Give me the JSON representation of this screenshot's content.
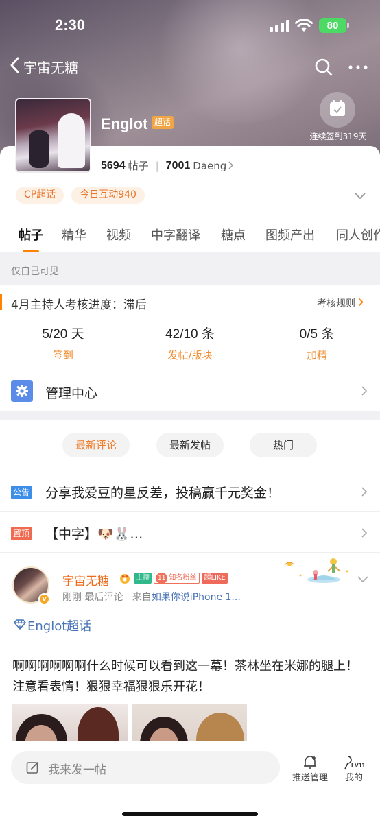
{
  "status_bar": {
    "time": "2:30",
    "battery": "80"
  },
  "nav": {
    "back_title": "宇宙无糖"
  },
  "topic": {
    "name": "Englot",
    "badge": "超话",
    "checkin_text": "连续签到319天",
    "posts_count": "5694",
    "posts_label": "帖子",
    "members_count": "7001",
    "members_label": "Daeng",
    "tags": [
      "CP超话",
      "今日互动940"
    ]
  },
  "tabs": [
    "帖子",
    "精华",
    "视频",
    "中字翻译",
    "糖点",
    "图频产出",
    "同人创作"
  ],
  "only_visible": "仅自己可见",
  "host_review": {
    "title": "4月主持人考核进度：滞后",
    "rule_link": "考核规则",
    "metrics": [
      {
        "value": "5/20 天",
        "label": "签到"
      },
      {
        "value": "42/10 条",
        "label": "发帖/版块"
      },
      {
        "value": "0/5 条",
        "label": "加精"
      }
    ],
    "management": "管理中心"
  },
  "sort_options": [
    "最新评论",
    "最新发帖",
    "热门"
  ],
  "notices": [
    {
      "badge": "公告",
      "text": "分享我爱豆的星反差，投稿赢千元奖金！",
      "color": "#3d8ee8"
    },
    {
      "badge": "置顶",
      "text": "【中字】🐶🐰…",
      "color": "#f06a52"
    }
  ],
  "post": {
    "user": "宇宙无糖",
    "badges": {
      "host": "主持",
      "fan": "知名粉丝",
      "fan_level": "11",
      "like": "超LIKE"
    },
    "time": "刚刚",
    "action": "最后评论",
    "source_prefix": "来自",
    "source": "如果你说iPhone 1...",
    "topic": "Englot超话",
    "text": "啊啊啊啊啊啊什么时候可以看到这一幕！茶林坐在米娜的腿上！注意看表情！狠狠幸福狠狠乐开花！"
  },
  "bottom_bar": {
    "compose_placeholder": "我来发一帖",
    "push_label": "推送管理",
    "mine_label": "我的",
    "level": "LV11"
  },
  "colors": {
    "accent": "#ff8200",
    "link": "#4a75b8"
  }
}
